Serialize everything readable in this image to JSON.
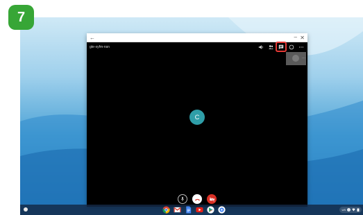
{
  "step_badge": "7",
  "window": {
    "back_glyph": "←",
    "minimize_glyph": "–",
    "close_glyph": "✕",
    "meeting_code": "gte-xyfm-nsn"
  },
  "top_toolbar": {
    "icons": [
      "volume-icon",
      "people-icon",
      "chat-icon",
      "captions-icon",
      "more-options-icon"
    ],
    "highlighted": "chat-icon",
    "highlight_color": "#e53935"
  },
  "self_view": {
    "more_glyph": "⋯"
  },
  "participant": {
    "initial": "C",
    "avatar_color": "#2f9ea8"
  },
  "controls": {
    "icons": [
      "microphone-icon",
      "hang-up-icon",
      "camera-off-icon"
    ],
    "hang_up_color": "#d93025",
    "camera_color": "#d93025"
  },
  "shelf": {
    "apps": [
      "chrome-icon",
      "gmail-icon",
      "docs-icon",
      "youtube-icon",
      "play-store-icon",
      "settings-icon"
    ],
    "tray_text": "US"
  }
}
